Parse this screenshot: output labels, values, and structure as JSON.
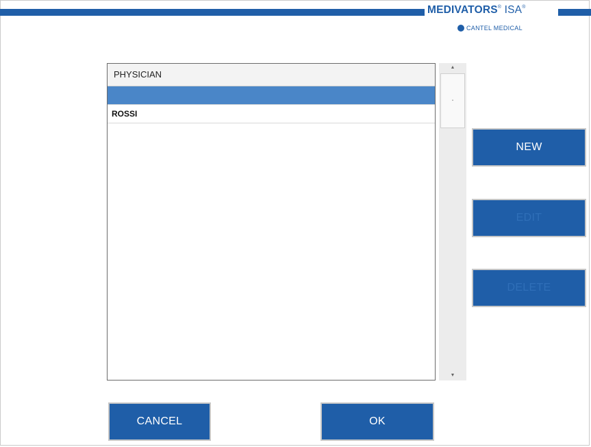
{
  "header": {
    "brand": "MEDIVATORS",
    "brand_suffix": "ISA",
    "subbrand": "CANTEL MEDICAL",
    "accent_color": "#1f5ea8"
  },
  "list": {
    "column_header": "PHYSICIAN",
    "rows": [
      {
        "label": "",
        "selected": true
      },
      {
        "label": "ROSSI",
        "selected": false
      }
    ]
  },
  "scrollbar": {
    "up_icon": "▲",
    "down_icon": "▼",
    "grip_icon": "▪"
  },
  "actions": {
    "new_label": "NEW",
    "edit_label": "EDIT",
    "delete_label": "DELETE"
  },
  "footer": {
    "cancel_label": "CANCEL",
    "ok_label": "OK"
  }
}
